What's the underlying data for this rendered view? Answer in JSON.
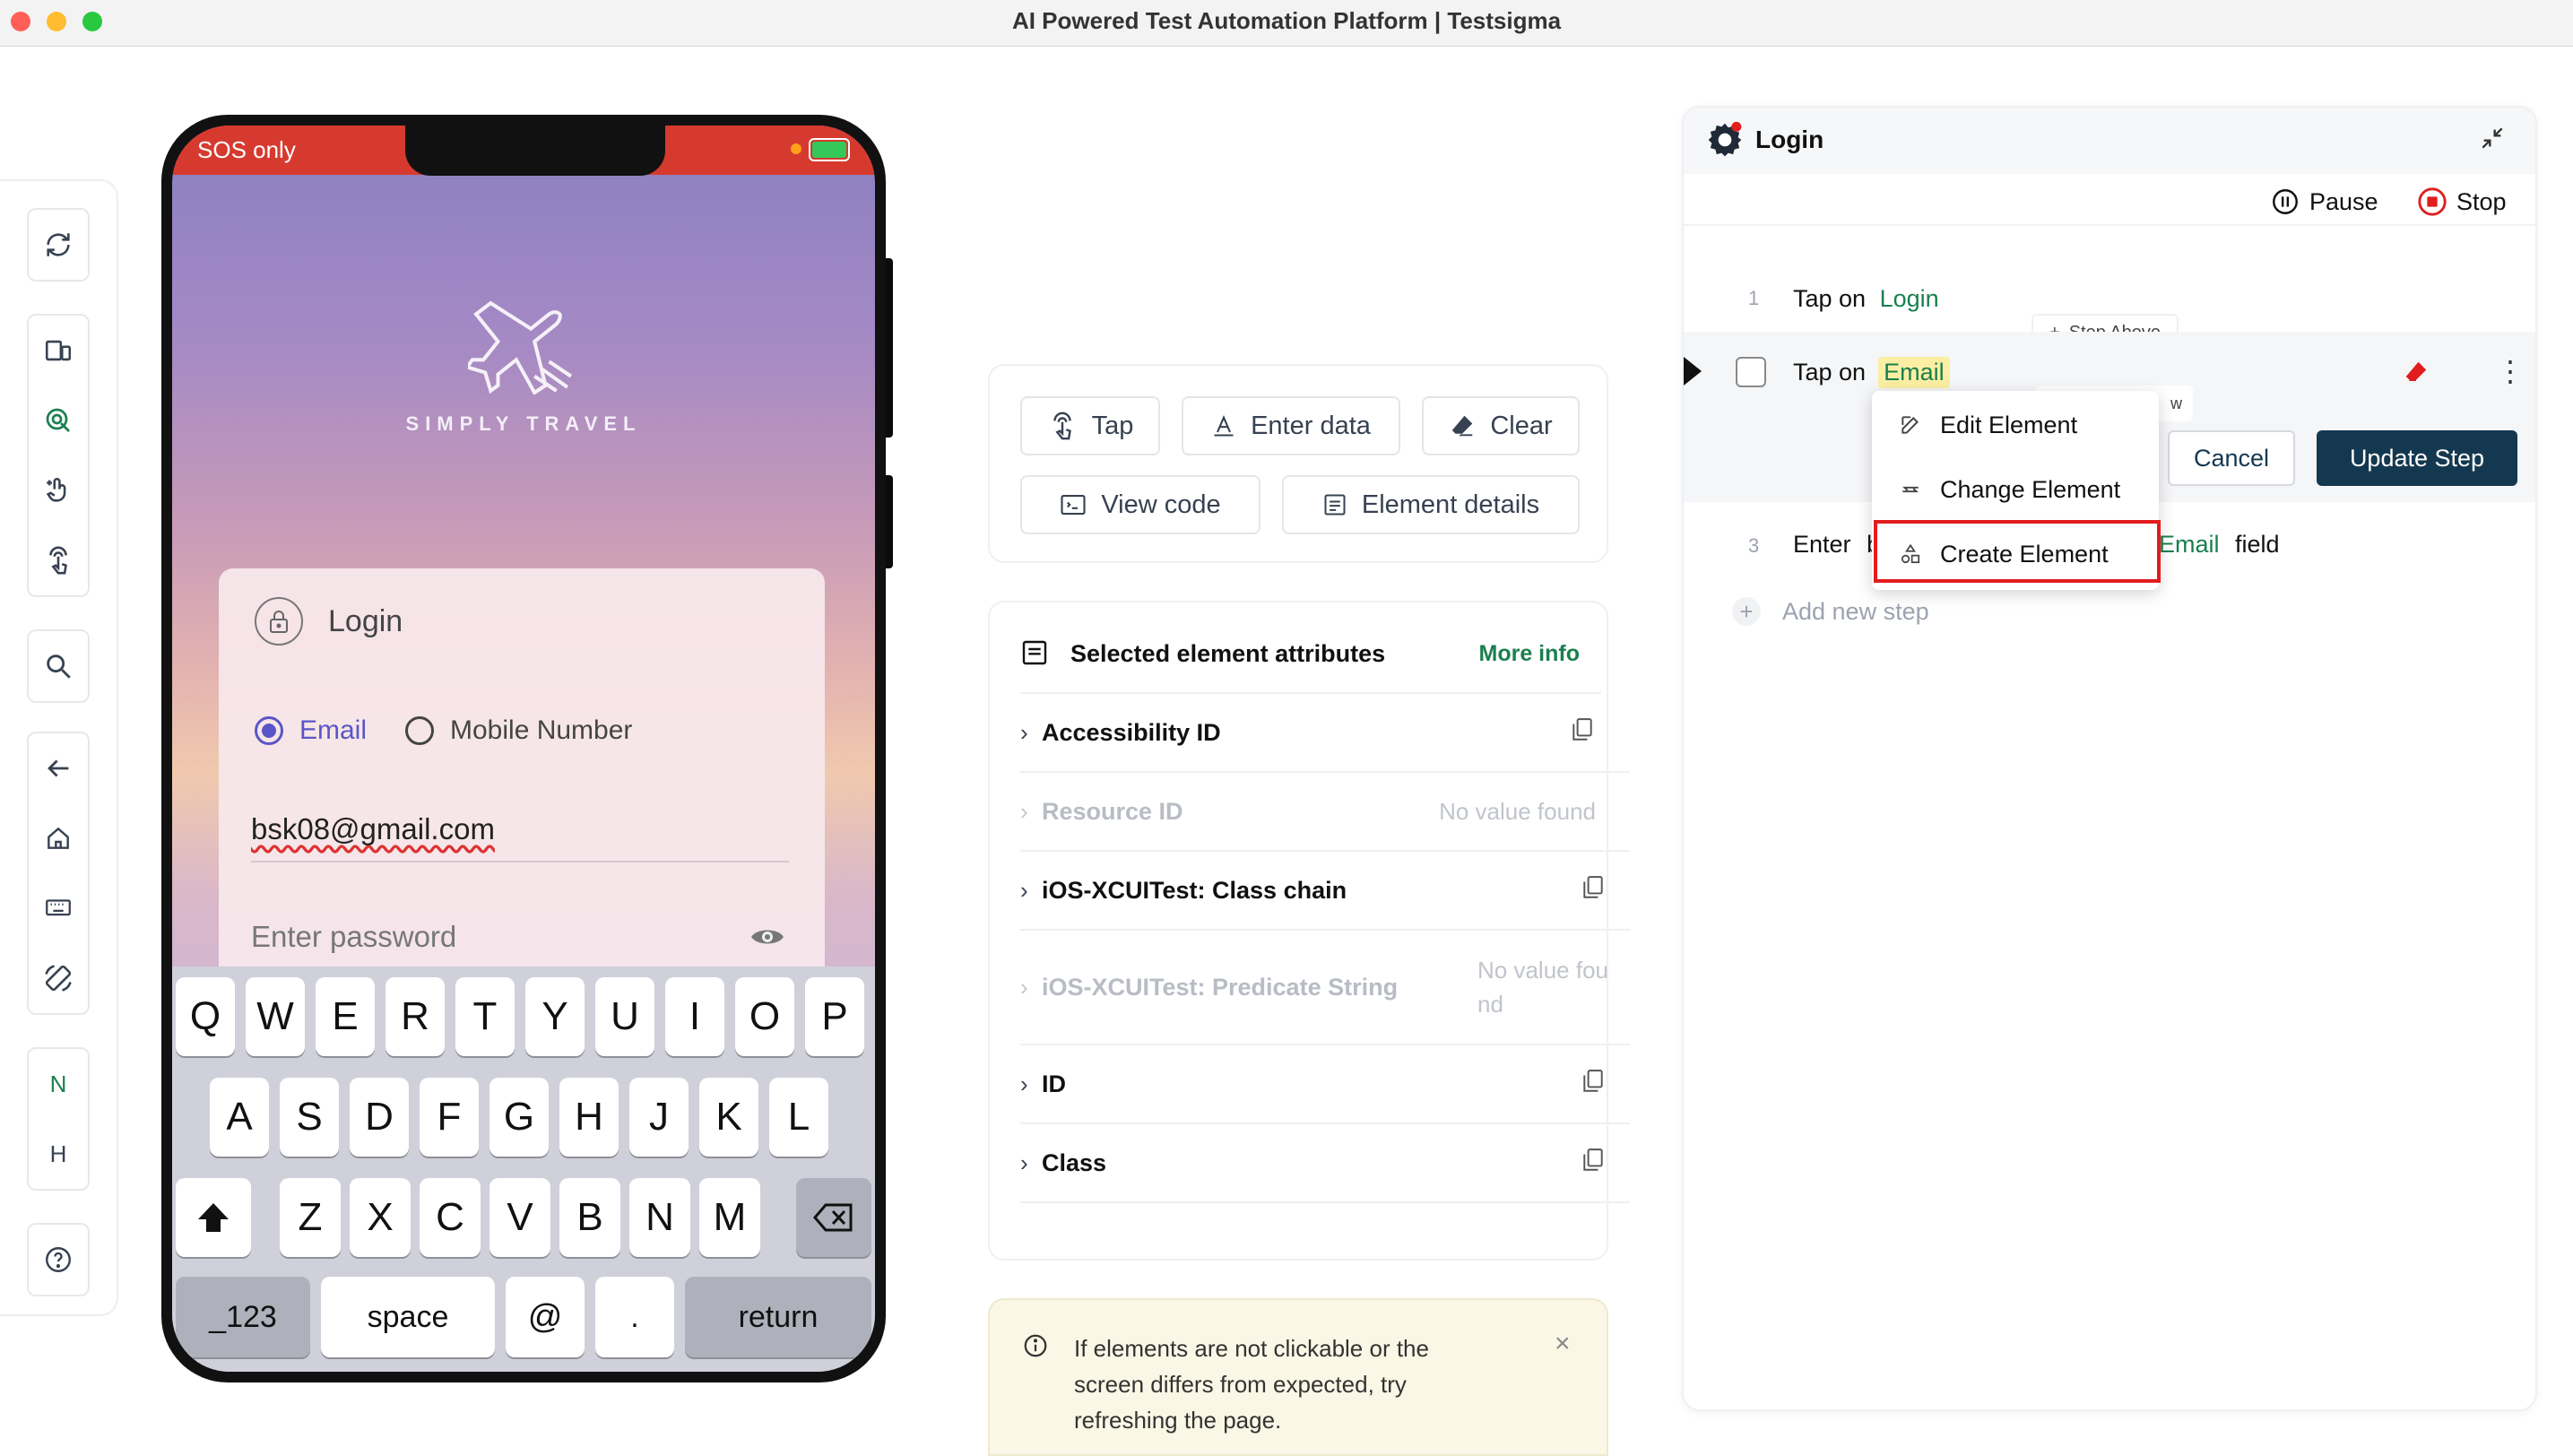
{
  "window": {
    "title": "AI Powered Test Automation Platform | Testsigma"
  },
  "toolbar": {
    "groups": [
      [
        "refresh-icon"
      ],
      [
        "devices-icon",
        "inspect-icon",
        "gesture-icon",
        "tap-icon"
      ],
      [
        "search-icon"
      ],
      [
        "back-arrow-icon",
        "home-icon",
        "keyboard-icon",
        "rotate-icon"
      ],
      [
        "N",
        "H"
      ],
      [
        "help-icon"
      ]
    ],
    "letters": {
      "n": "N",
      "h": "H"
    },
    "active_color": "#1a7f4f"
  },
  "phone": {
    "status": "SOS only",
    "brand": "SIMPLY TRAVEL",
    "login_title": "Login",
    "radio_email": "Email",
    "radio_mobile": "Mobile Number",
    "email_value": "bsk08@gmail.com",
    "password_placeholder": "Enter password",
    "keyboard": {
      "row1": [
        "Q",
        "W",
        "E",
        "R",
        "T",
        "Y",
        "U",
        "I",
        "O",
        "P"
      ],
      "row2": [
        "A",
        "S",
        "D",
        "F",
        "G",
        "H",
        "J",
        "K",
        "L"
      ],
      "row3": [
        "Z",
        "X",
        "C",
        "V",
        "B",
        "N",
        "M"
      ],
      "bottom": {
        "numbers": "_123",
        "space": "space",
        "at": "@",
        "dot": ".",
        "return": "return"
      }
    }
  },
  "actions": {
    "tap": "Tap",
    "enter_data": "Enter data",
    "clear": "Clear",
    "view_code": "View code",
    "element_details": "Element details"
  },
  "attributes": {
    "title": "Selected element attributes",
    "more_info": "More info",
    "rows": [
      {
        "name": "Accessibility ID",
        "value": ""
      },
      {
        "name": "Resource ID",
        "value": "No value found"
      },
      {
        "name": "iOS-XCUITest: Class chain",
        "value": ""
      },
      {
        "name": "iOS-XCUITest: Predicate String",
        "value_line1": "No value fou",
        "value_line2": "nd"
      },
      {
        "name": "ID",
        "value": ""
      },
      {
        "name": "Class",
        "value": ""
      }
    ]
  },
  "notice": {
    "line1": "If elements are not clickable or the",
    "line2": "screen differs from expected, try",
    "line3": "refreshing the page."
  },
  "recorder": {
    "title": "Login",
    "pause": "Pause",
    "stop": "Stop",
    "steps": [
      {
        "num": "1",
        "action": "Tap on",
        "target": "Login"
      },
      {
        "num": "",
        "action": "Tap on",
        "target": "Email"
      },
      {
        "num": "3",
        "action": "Enter",
        "partial": "b",
        "target": "Email",
        "suffix": "field"
      }
    ],
    "step_above": "Step Above",
    "step_below_fragment": "w",
    "cancel": "Cancel",
    "update_step": "Update Step",
    "add_new_step": "Add new step",
    "menu": [
      "Edit Element",
      "Change Element",
      "Create Element"
    ],
    "primary_color": "#14384f",
    "highlight_color": "#e11d1d"
  }
}
